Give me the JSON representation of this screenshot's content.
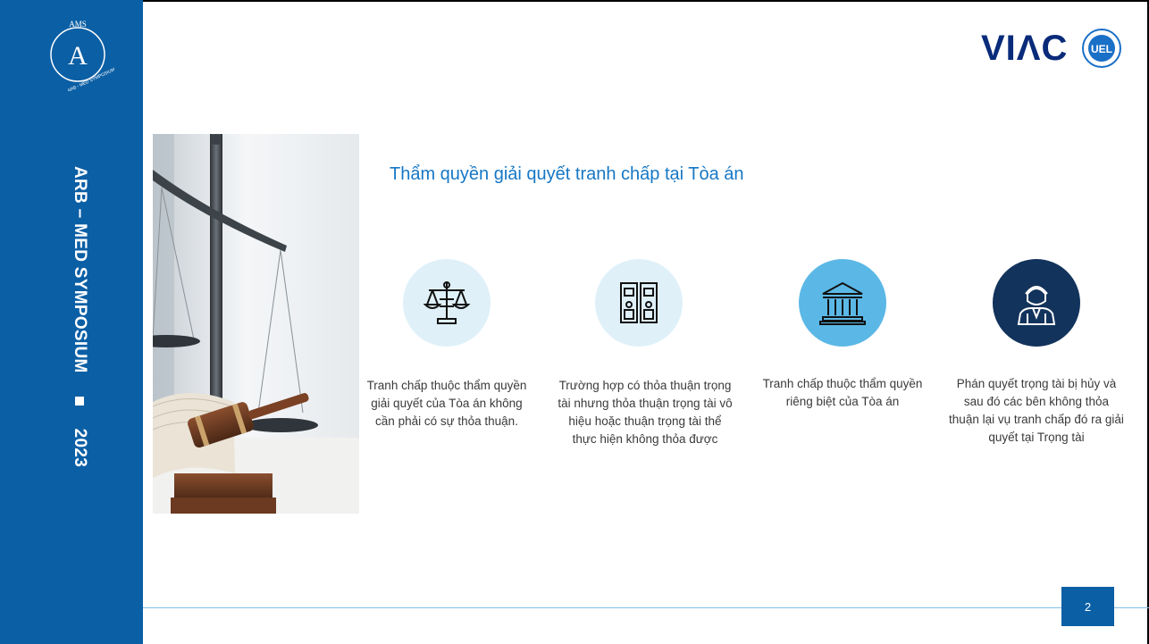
{
  "sidebar": {
    "logo_letter": "A",
    "logo_top": "AMS",
    "logo_ring": "ARB - MED SYMPOSIUM",
    "vertical_text": "ARB – MED SYMPOSIUM",
    "year": "2023"
  },
  "header": {
    "viac_logo": "VIΛC",
    "uel_logo": "UEL"
  },
  "slide": {
    "title": "Thẩm quyền giải quyết tranh chấp tại Tòa án",
    "items": [
      {
        "icon": "scales-icon",
        "caption": "Tranh chấp thuộc thẩm quyền giải quyết của Tòa án không cần phải có sự thỏa thuận."
      },
      {
        "icon": "binders-icon",
        "caption": "Trường hợp có thỏa thuận trọng tài nhưng thỏa thuận trọng tài vô hiệu hoặc thuận trọng tài thể thực hiện không thỏa được"
      },
      {
        "icon": "courthouse-icon",
        "caption": "Tranh chấp thuộc thẩm quyền riêng biệt của Tòa án"
      },
      {
        "icon": "judge-icon",
        "caption": "Phán quyết trọng tài bị hủy và sau đó các bên không thỏa thuận lại vụ tranh chấp đó ra giải quyết tại Trọng tài"
      }
    ],
    "page_number": "2"
  },
  "colors": {
    "sidebar": "#0b5fa5",
    "title": "#1677c5",
    "viac": "#0a2b7a",
    "icon_light": "#dff0f8",
    "icon_mid": "#5bb8e6",
    "icon_dark": "#12335c"
  }
}
